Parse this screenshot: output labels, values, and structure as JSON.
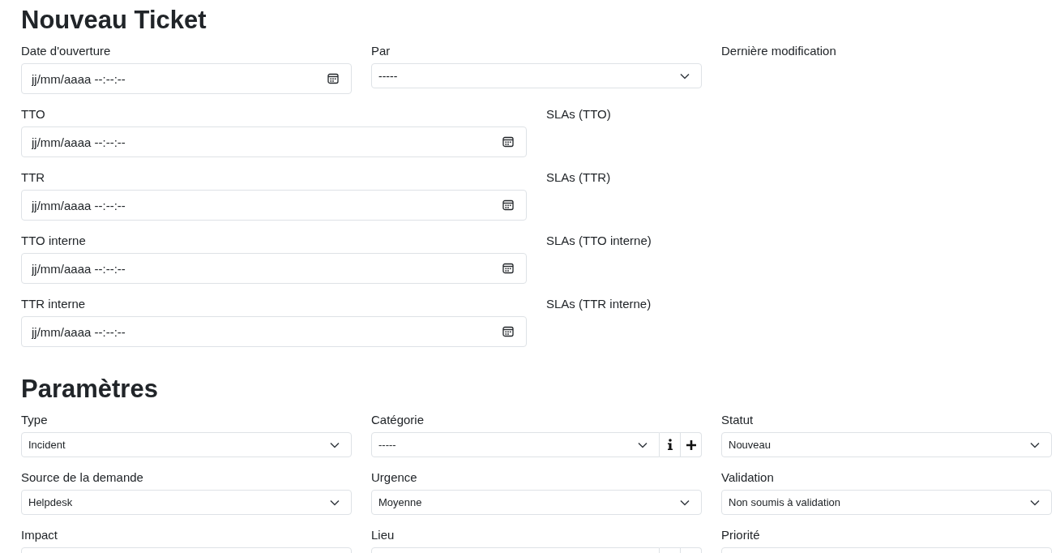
{
  "title": "Nouveau Ticket",
  "header": {
    "opening": {
      "label": "Date d'ouverture",
      "placeholder": "jj/mm/aaaa --:--:--"
    },
    "by": {
      "label": "Par",
      "value": "-----"
    },
    "last_modified": {
      "label": "Dernière modification"
    }
  },
  "deadlines": [
    {
      "label": "TTO",
      "placeholder": "jj/mm/aaaa --:--:--",
      "sla_label": "SLAs (TTO)"
    },
    {
      "label": "TTR",
      "placeholder": "jj/mm/aaaa --:--:--",
      "sla_label": "SLAs (TTR)"
    },
    {
      "label": "TTO interne",
      "placeholder": "jj/mm/aaaa --:--:--",
      "sla_label": "SLAs (TTO interne)"
    },
    {
      "label": "TTR interne",
      "placeholder": "jj/mm/aaaa --:--:--",
      "sla_label": "SLAs (TTR interne)"
    }
  ],
  "parameters": {
    "title": "Paramètres",
    "fields": [
      {
        "label": "Type",
        "kind": "select",
        "value": "Incident"
      },
      {
        "label": "Catégorie",
        "kind": "select_with_actions",
        "value": "-----"
      },
      {
        "label": "Statut",
        "kind": "select",
        "value": "Nouveau"
      },
      {
        "label": "Source de la demande",
        "kind": "select",
        "value": "Helpdesk"
      },
      {
        "label": "Urgence",
        "kind": "select",
        "value": "Moyenne"
      },
      {
        "label": "Validation",
        "kind": "select",
        "value": "Non soumis à validation"
      },
      {
        "label": "Impact",
        "kind": "select"
      },
      {
        "label": "Lieu",
        "kind": "select_with_actions"
      },
      {
        "label": "Priorité",
        "kind": "select"
      }
    ]
  }
}
